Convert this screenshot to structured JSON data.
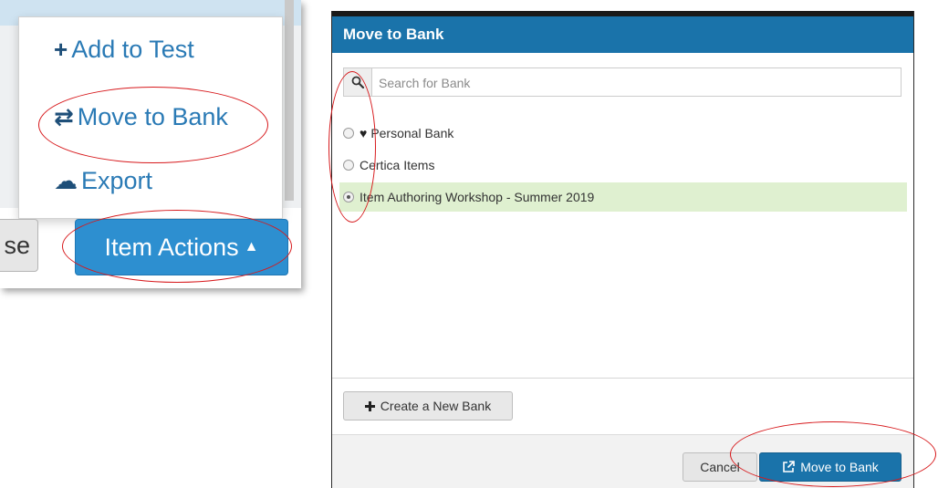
{
  "left_panel": {
    "menu": {
      "items": [
        {
          "icon": "plus-icon",
          "glyph": "+",
          "label": "Add to Test"
        },
        {
          "icon": "exchange-arrows-icon",
          "glyph": "⇄",
          "label": "Move to Bank"
        },
        {
          "icon": "cloud-download-icon",
          "glyph": "☁",
          "label": "Export"
        }
      ]
    },
    "close_button_partial_label": "se",
    "item_actions_button": {
      "label": "Item Actions",
      "caret": "▲"
    }
  },
  "modal": {
    "title": "Move to Bank",
    "search": {
      "placeholder": "Search for Bank",
      "value": ""
    },
    "banks": [
      {
        "label": "Personal Bank",
        "icon": "heart-icon",
        "selected": false
      },
      {
        "label": "Certica Items",
        "selected": false
      },
      {
        "label": "Item Authoring Workshop - Summer 2019",
        "selected": true
      }
    ],
    "create_button": {
      "icon": "plus-icon",
      "label": "Create a New Bank"
    },
    "cancel_label": "Cancel",
    "move_button": {
      "icon": "external-link-icon",
      "label": "Move to Bank"
    }
  },
  "colors": {
    "primary": "#1a73aa",
    "selected_row": "#dff0d0",
    "annotation": "#d7191c",
    "menu_link": "#2a7ab5"
  }
}
